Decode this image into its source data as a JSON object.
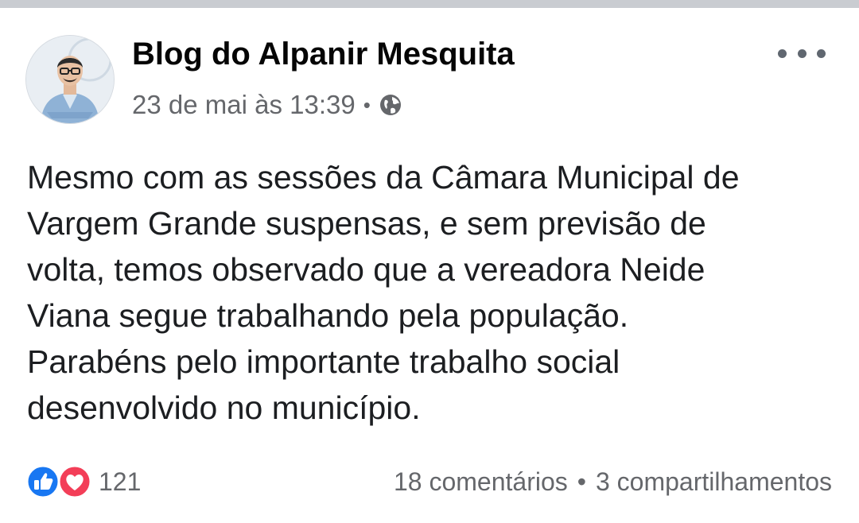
{
  "post": {
    "author": "Blog do Alpanir Mesquita",
    "timestamp": "23 de mai às 13:39",
    "separator": "•",
    "privacy_icon": "globe-icon",
    "more_icon": "more-options-icon",
    "text": "Mesmo com as sessões da Câmara Municipal de\nVargem Grande suspensas, e sem previsão de\nvolta, temos observado que a vereadora Neide\nViana segue trabalhando pela população.\nParabéns pelo importante trabalho social\ndesenvolvido no município."
  },
  "footer": {
    "reaction_icons": [
      "like-icon",
      "love-icon"
    ],
    "reaction_count": "121",
    "comments": "18 comentários",
    "separator": "•",
    "shares": "3 compartilhamentos"
  },
  "colors": {
    "like_blue": "#1877f2",
    "love_red": "#f33e58",
    "secondary_text": "#65676b",
    "top_bar": "#c9ccd1"
  }
}
